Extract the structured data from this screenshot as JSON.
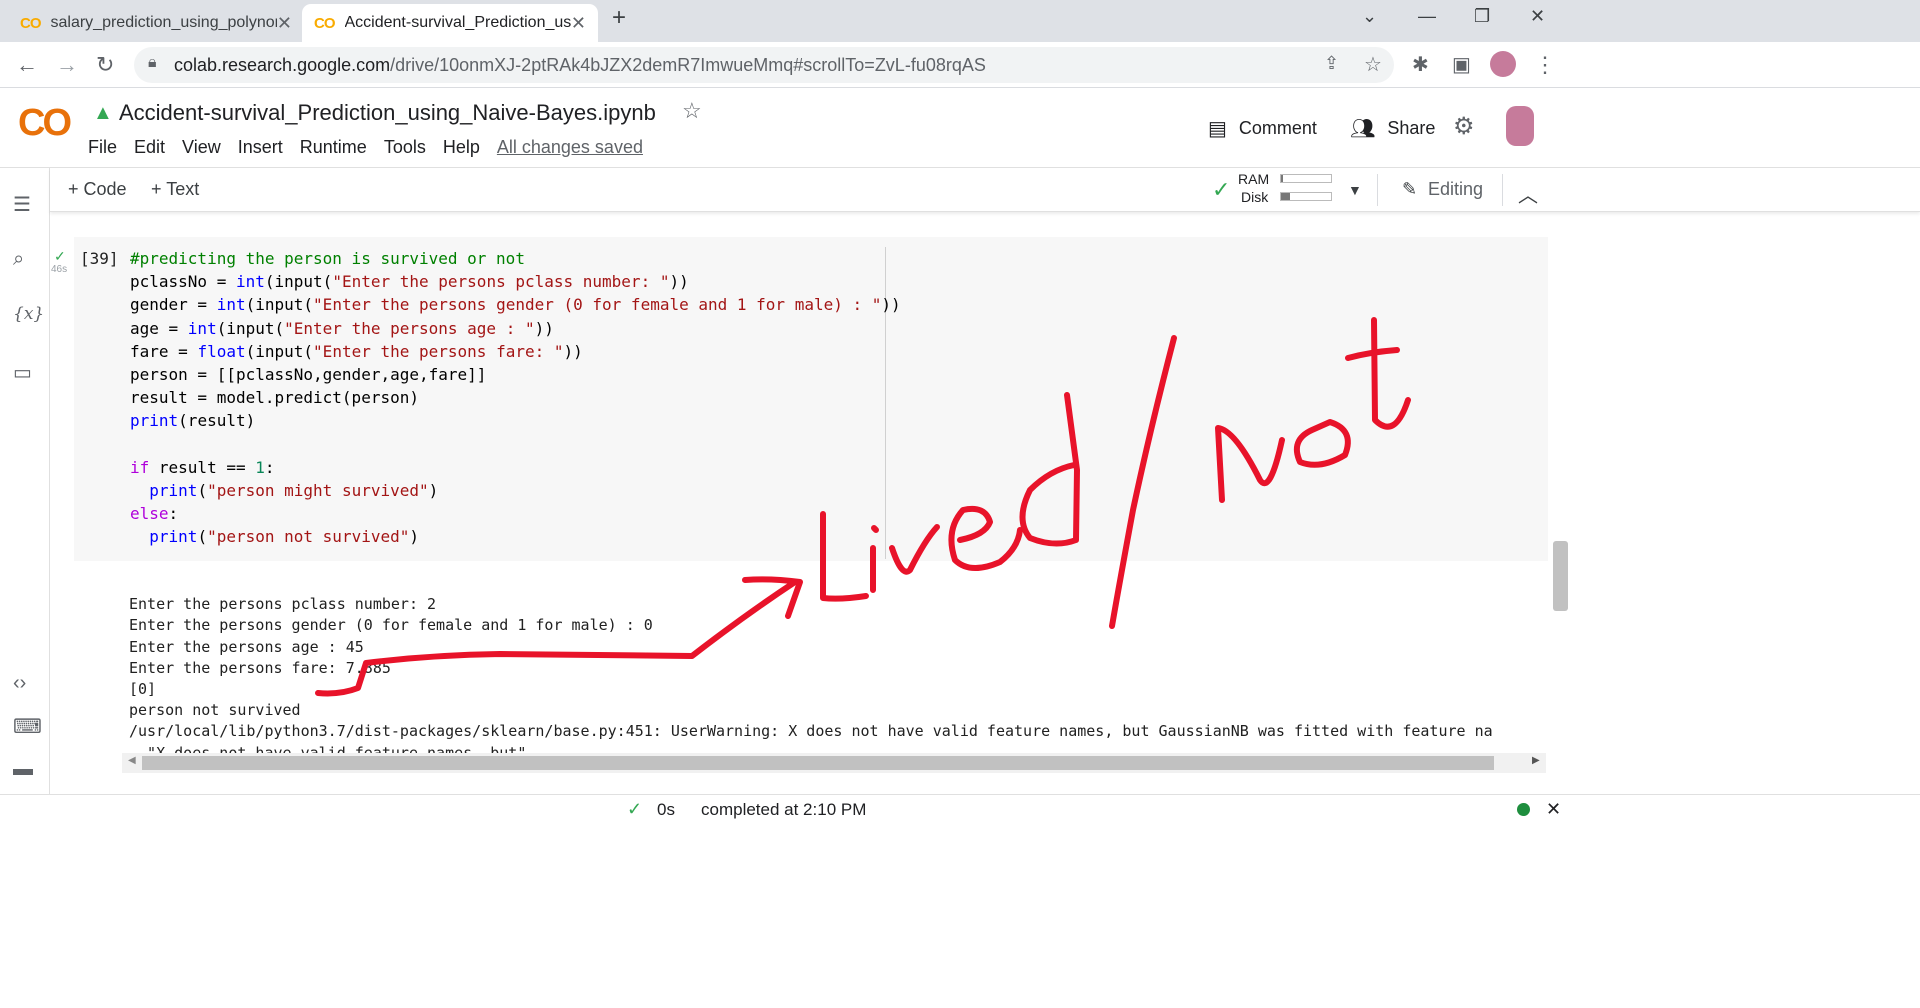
{
  "browser": {
    "tabs": [
      {
        "label": "salary_prediction_using_polynomi",
        "icon": "colab-icon"
      },
      {
        "label": "Accident-survival_Prediction_usin",
        "icon": "colab-icon",
        "active": true
      }
    ],
    "url_host": "colab.research.google.com",
    "url_path": "/drive/10onmXJ-2ptRAk4bJZX2demR7ImwueMmq#scrollTo=ZvL-fu08rqAS"
  },
  "header": {
    "logo": "CO",
    "notebook_title": "Accident-survival_Prediction_using_Naive-Bayes.ipynb",
    "menu": [
      "File",
      "Edit",
      "View",
      "Insert",
      "Runtime",
      "Tools",
      "Help"
    ],
    "save_status": "All changes saved",
    "comment_label": "Comment",
    "share_label": "Share"
  },
  "toolbar": {
    "add_code": "+ Code",
    "add_text": "+ Text",
    "ram_label": "RAM",
    "disk_label": "Disk",
    "editing_label": "Editing"
  },
  "cell": {
    "exec_count": "[39]",
    "exec_time": "46s",
    "output_lines": [
      "Enter the persons pclass number: 2",
      "Enter the persons gender (0 for female and 1 for male) : 0",
      "Enter the persons age : 45",
      "Enter the persons fare: 7.885",
      "[0]",
      "person not survived",
      "/usr/local/lib/python3.7/dist-packages/sklearn/base.py:451: UserWarning: X does not have valid feature names, but GaussianNB was fitted with feature na",
      "  \"X does not have valid feature names, but\""
    ]
  },
  "status": {
    "duration": "0s",
    "completed": "completed at 2:10 PM"
  },
  "annotation": {
    "text": "Lived/Not",
    "color": "#e8132a"
  },
  "colors": {
    "accent_orange": "#f9ab00",
    "check_green": "#34a853"
  }
}
